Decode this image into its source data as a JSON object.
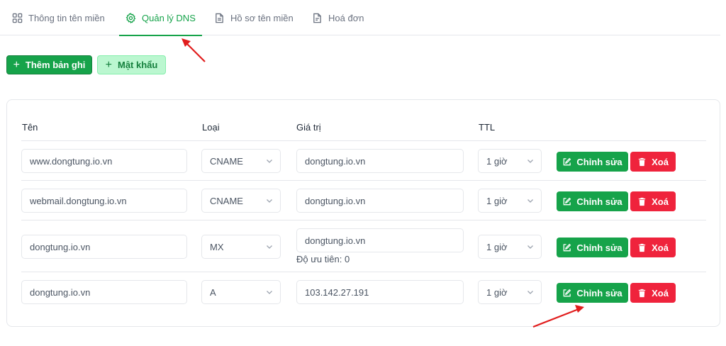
{
  "tabs": [
    {
      "label": "Thông tin tên miền",
      "icon": "grid-icon",
      "active": false
    },
    {
      "label": "Quản lý DNS",
      "icon": "gear-icon",
      "active": true
    },
    {
      "label": "Hồ sơ tên miền",
      "icon": "document-icon",
      "active": false
    },
    {
      "label": "Hoá đơn",
      "icon": "invoice-icon",
      "active": false
    }
  ],
  "toolbar": {
    "add_record_label": "Thêm bản ghi",
    "password_label": "Mật khẩu"
  },
  "table": {
    "headers": {
      "name": "Tên",
      "type": "Loại",
      "value": "Giá trị",
      "ttl": "TTL"
    },
    "rows": [
      {
        "name": "www.dongtung.io.vn",
        "type": "CNAME",
        "value": "dongtung.io.vn",
        "ttl": "1 giờ",
        "edit_label": "Chỉnh sửa",
        "delete_label": "Xoá"
      },
      {
        "name": "webmail.dongtung.io.vn",
        "type": "CNAME",
        "value": "dongtung.io.vn",
        "ttl": "1 giờ",
        "edit_label": "Chỉnh sửa",
        "delete_label": "Xoá"
      },
      {
        "name": "dongtung.io.vn",
        "type": "MX",
        "value": "dongtung.io.vn",
        "priority": "Độ ưu tiên: 0",
        "ttl": "1 giờ",
        "edit_label": "Chỉnh sửa",
        "delete_label": "Xoá"
      },
      {
        "name": "dongtung.io.vn",
        "type": "A",
        "value": "103.142.27.191",
        "ttl": "1 giờ",
        "edit_label": "Chỉnh sửa",
        "delete_label": "Xoá"
      }
    ]
  },
  "colors": {
    "accent": "#16a34a",
    "danger": "#ef233c",
    "annotation_arrow": "#e11d1d"
  }
}
